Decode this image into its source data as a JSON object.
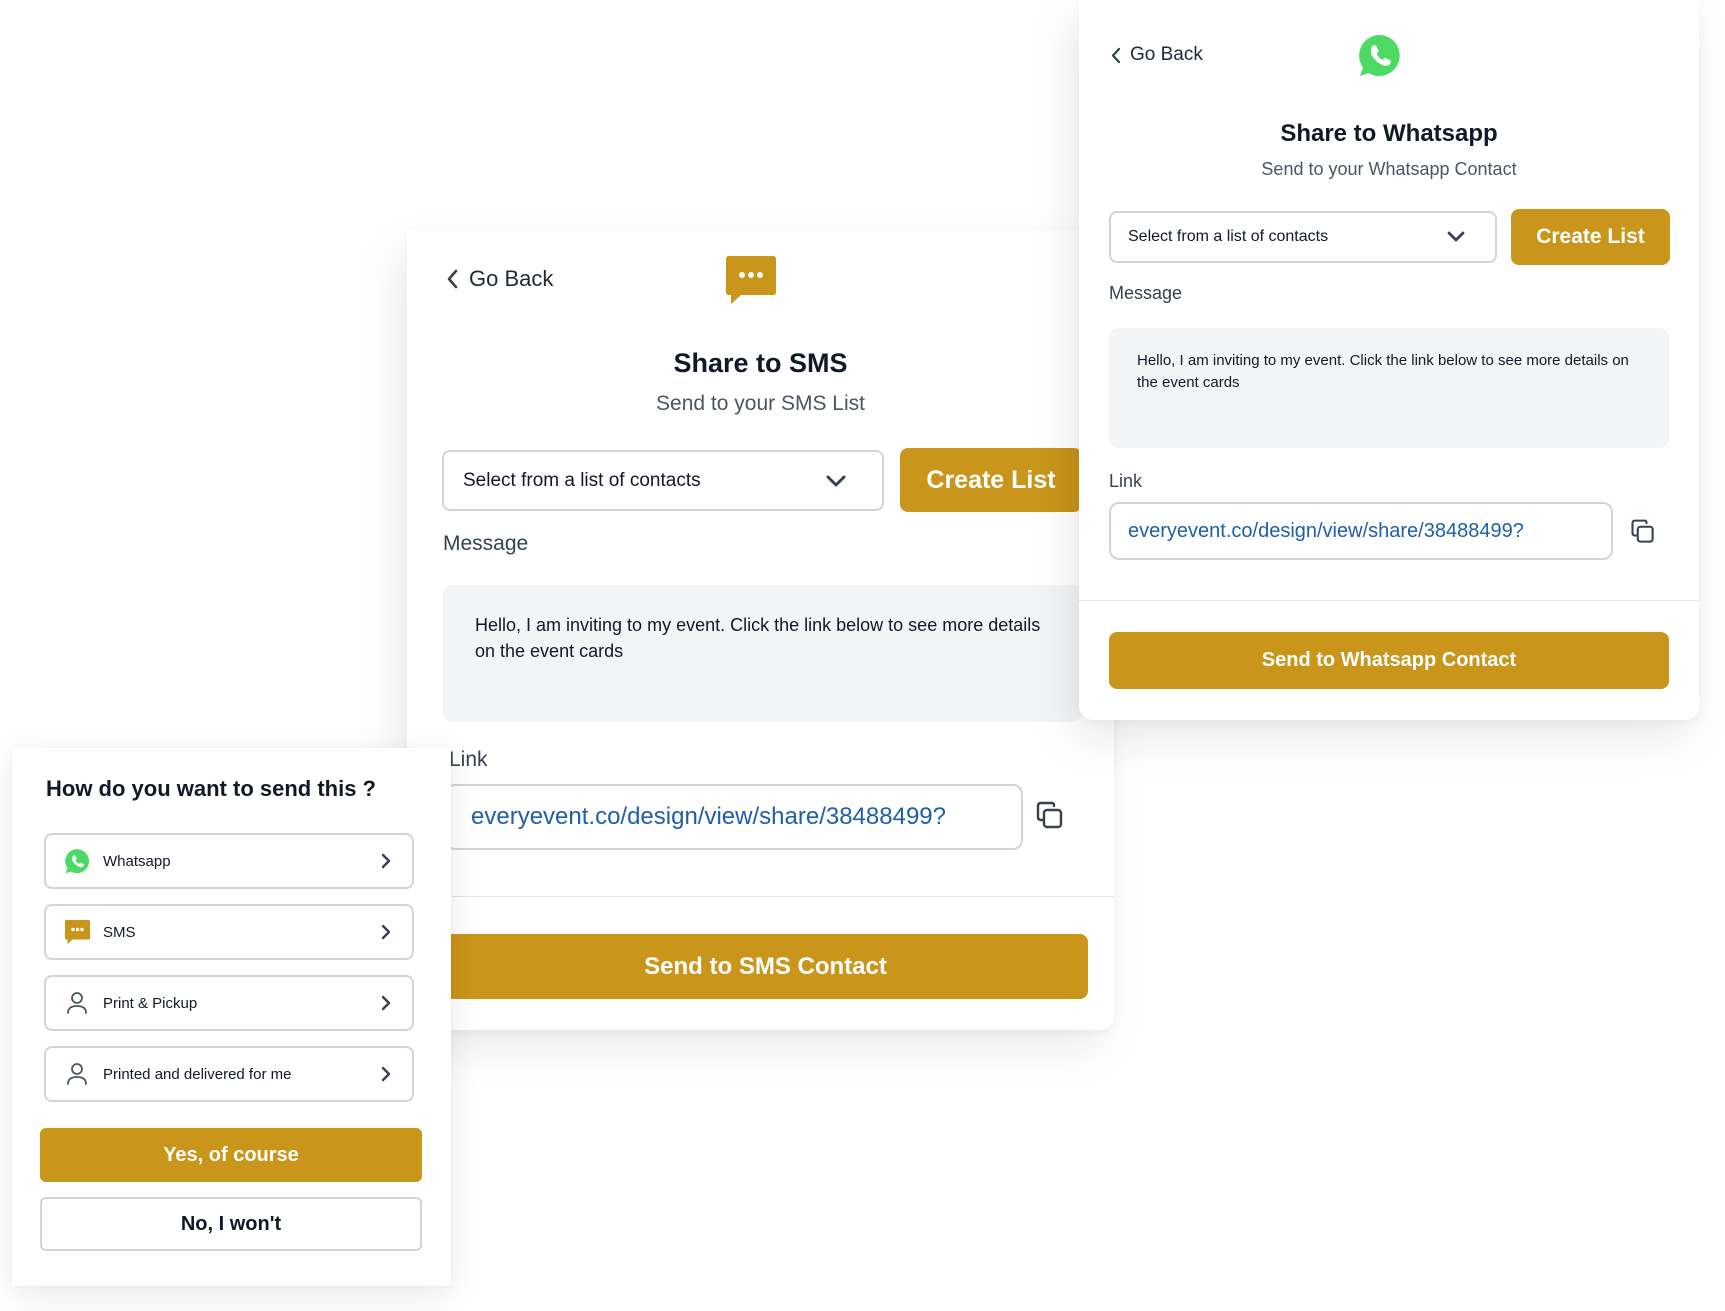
{
  "colors": {
    "accent": "#c9951a",
    "link": "#1d5fa8",
    "whatsapp": "#4cd964",
    "border": "#d1d5db",
    "message_bg": "#f3f4f6"
  },
  "sms_panel": {
    "back_label": "Go Back",
    "icon": "sms-chat-icon",
    "title": "Share to SMS",
    "subtitle": "Send to your SMS List",
    "select_value": "Select from a list of contacts",
    "create_list_label": "Create List",
    "message_label": "Message",
    "message_text": "Hello, I am inviting to my event. Click the link below to see more details on the event cards",
    "link_label": "Link",
    "link_value": "everyevent.co/design/view/share/38488499?",
    "send_label": "Send to SMS Contact"
  },
  "whatsapp_panel": {
    "back_label": "Go Back",
    "icon": "whatsapp-icon",
    "title": "Share to Whatsapp",
    "subtitle": "Send to your Whatsapp Contact",
    "select_value": "Select from a list of contacts",
    "create_list_label": "Create List",
    "message_label": "Message",
    "message_text": "Hello, I am inviting to my event. Click the link below to see more details on the event cards",
    "link_label": "Link",
    "link_value": "everyevent.co/design/view/share/38488499?",
    "send_label": "Send to Whatsapp Contact"
  },
  "send_options": {
    "heading": "How do you want to send this ?",
    "options": [
      {
        "label": "Whatsapp",
        "icon": "whatsapp-icon"
      },
      {
        "label": "SMS",
        "icon": "sms-chat-icon"
      },
      {
        "label": "Print & Pickup",
        "icon": "person-icon"
      },
      {
        "label": "Printed and delivered for me",
        "icon": "person-icon"
      }
    ],
    "confirm_label": "Yes, of course",
    "decline_label": "No, I won't"
  }
}
